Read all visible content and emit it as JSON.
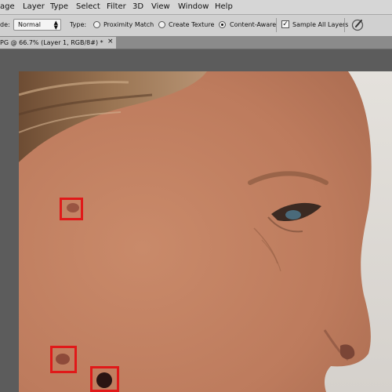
{
  "menu": {
    "items": [
      "age",
      "Layer",
      "Type",
      "Select",
      "Filter",
      "3D",
      "View",
      "Window",
      "Help"
    ]
  },
  "options": {
    "mode_label": "de:",
    "mode_value": "Normal",
    "type_label": "Type:",
    "radio_proximity": "Proximity Match",
    "radio_texture": "Create Texture",
    "radio_content": "Content-Aware",
    "selected_type": "Content-Aware",
    "sample_all_layers": "Sample All Layers",
    "sample_all_layers_checked": true,
    "tool_icon": "pressure-brush-icon"
  },
  "document": {
    "tab_title": "PG @ 66.7% (Layer 1, RGB/8#) *",
    "close_glyph": "×"
  },
  "canvas": {
    "subject": "close-up side profile of a woman's face",
    "highlight_color": "#e01919",
    "spot_count": 3
  }
}
